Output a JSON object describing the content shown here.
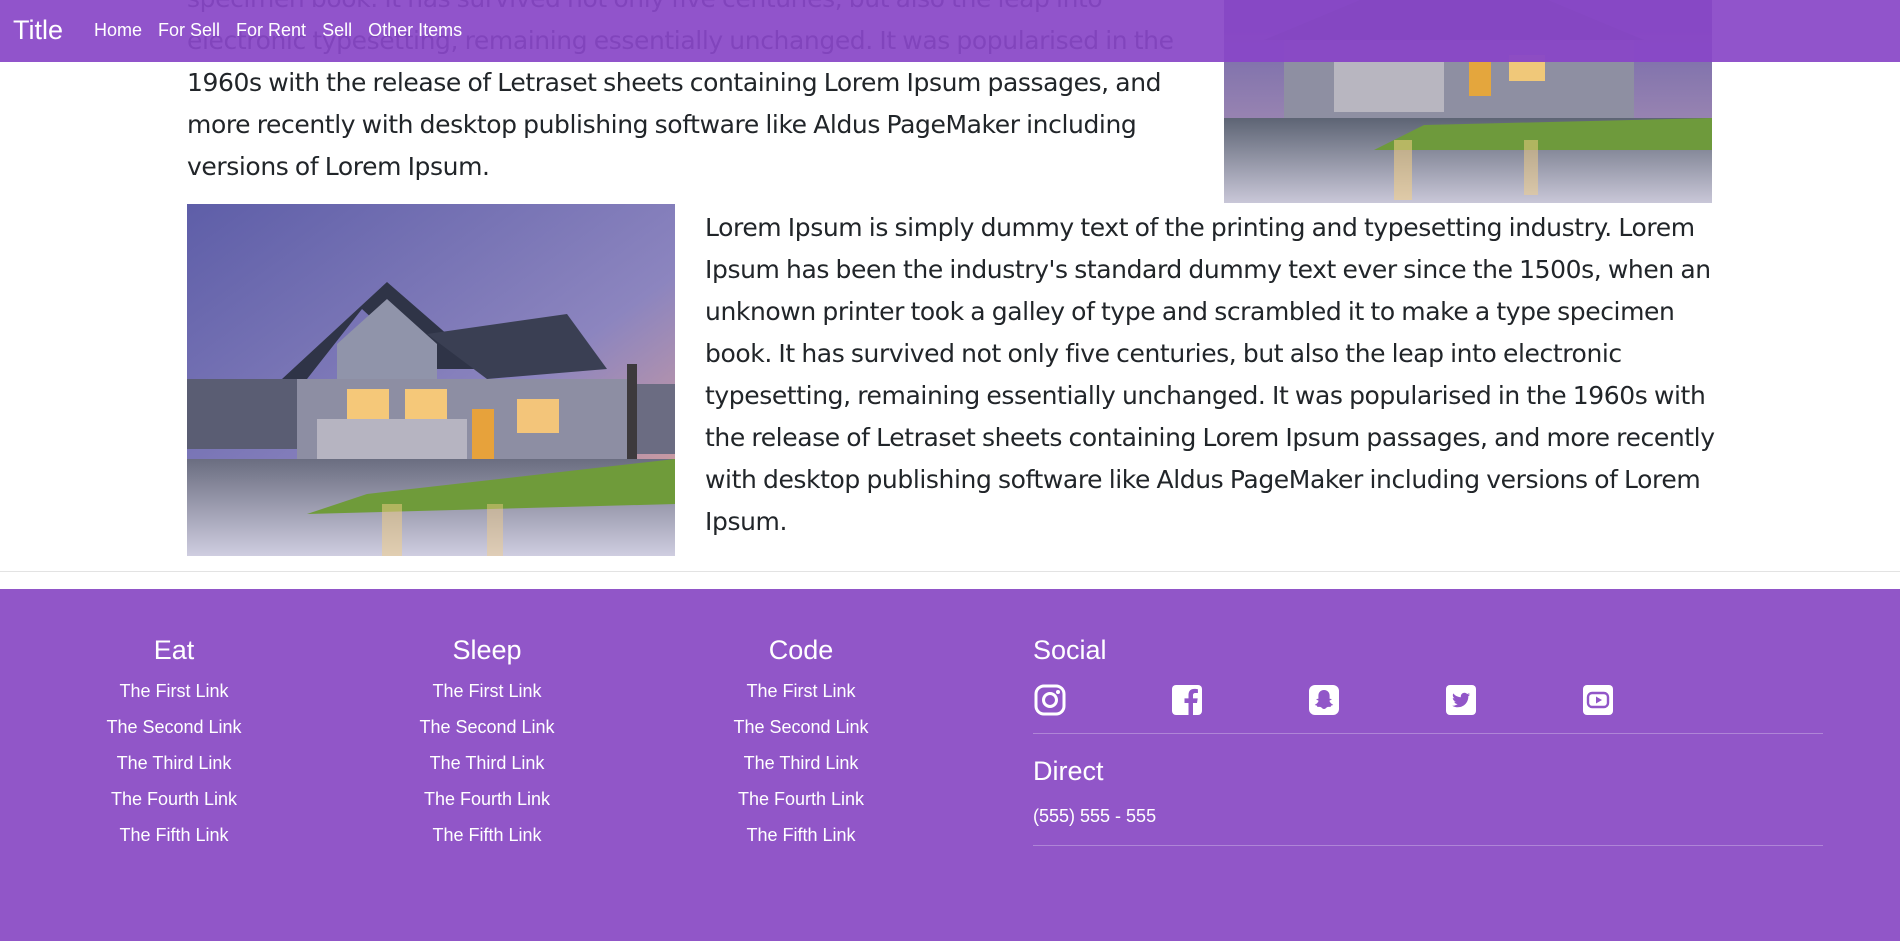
{
  "navbar": {
    "brand": "Title",
    "links": [
      "Home",
      "For Sell",
      "For Rent",
      "Sell",
      "Other Items"
    ]
  },
  "main": {
    "paragraph_1": "specimen book. It has survived not only five centuries, but also the leap into electronic typesetting, remaining essentially unchanged. It was popularised in the 1960s with the release of Letraset sheets containing Lorem Ipsum passages, and more recently with desktop publishing software like Aldus PageMaker including versions of Lorem Ipsum.",
    "paragraph_2": "Lorem Ipsum is simply dummy text of the printing and typesetting industry. Lorem Ipsum has been the industry's standard dummy text ever since the 1500s, when an unknown printer took a galley of type and scrambled it to make a type specimen book. It has survived not only five centuries, but also the leap into electronic typesetting, remaining essentially unchanged. It was popularised in the 1960s with the release of Letraset sheets containing Lorem Ipsum passages, and more recently with desktop publishing software like Aldus PageMaker including versions of Lorem Ipsum."
  },
  "footer": {
    "columns": [
      {
        "title": "Eat",
        "links": [
          "The First Link",
          "The Second Link",
          "The Third Link",
          "The Fourth Link",
          "The Fifth Link"
        ]
      },
      {
        "title": "Sleep",
        "links": [
          "The First Link",
          "The Second Link",
          "The Third Link",
          "The Fourth Link",
          "The Fifth Link"
        ]
      },
      {
        "title": "Code",
        "links": [
          "The First Link",
          "The Second Link",
          "The Third Link",
          "The Fourth Link",
          "The Fifth Link"
        ]
      }
    ],
    "social_title": "Social",
    "social_icons": [
      "instagram-icon",
      "facebook-icon",
      "snapchat-icon",
      "twitter-icon",
      "youtube-icon"
    ],
    "direct_title": "Direct",
    "phone": "(555) 555 - 555"
  },
  "colors": {
    "accent": "#9156c8",
    "navbar": "#8947c7",
    "text": "#212529"
  }
}
